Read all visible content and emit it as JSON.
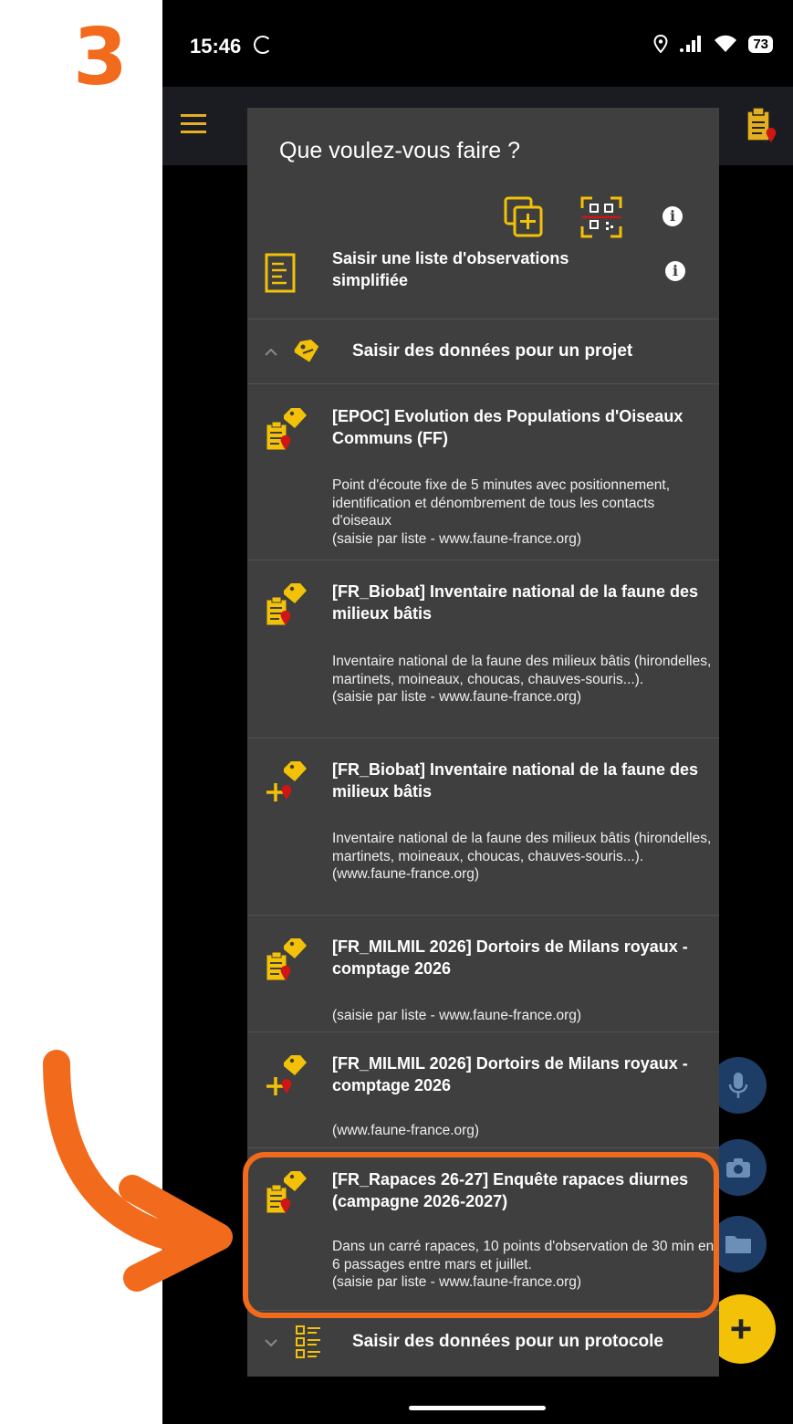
{
  "annotation": {
    "step_number": "3",
    "accent_color": "#f26a1b"
  },
  "status_bar": {
    "time": "15:46",
    "battery": "73",
    "icons": [
      "location-icon",
      "signal-icon",
      "wifi-icon",
      "battery-icon"
    ]
  },
  "dialog": {
    "title": "Que voulez-vous faire ?",
    "toolbar_icons": [
      "duplicate-add-icon",
      "qr-scan-icon",
      "info-icon"
    ],
    "simple_list": {
      "label": "Saisir une liste d'observations simplifiée",
      "icon": "list-icon"
    },
    "projects_section": {
      "label": "Saisir des données pour un projet",
      "expanded": true
    },
    "projects": [
      {
        "title": "[EPOC] Evolution des Populations d'Oiseaux Communs (FF)",
        "description": "Point d'écoute fixe de 5 minutes avec positionnement, identification et dénombrement de tous les contacts d'oiseaux\n(saisie par liste - www.faune-france.org)",
        "icon": "project-list-icon"
      },
      {
        "title": "[FR_Biobat] Inventaire national de la faune des milieux bâtis",
        "description": "Inventaire national de la faune des milieux bâtis (hirondelles, martinets, moineaux, choucas, chauves-souris...).\n(saisie par liste - www.faune-france.org)",
        "icon": "project-list-icon"
      },
      {
        "title": "[FR_Biobat] Inventaire national de la faune des milieux bâtis",
        "description": "Inventaire national de la faune des milieux bâtis (hirondelles, martinets, moineaux, choucas, chauves-souris...).\n(www.faune-france.org)",
        "icon": "project-add-icon"
      },
      {
        "title": "[FR_MILMIL 2026] Dortoirs de Milans royaux - comptage 2026",
        "description": "(saisie par liste - www.faune-france.org)",
        "icon": "project-list-icon"
      },
      {
        "title": "[FR_MILMIL 2026] Dortoirs de Milans royaux - comptage 2026",
        "description": "(www.faune-france.org)",
        "icon": "project-add-icon"
      },
      {
        "title": "[FR_Rapaces 26-27] Enquête rapaces diurnes (campagne 2026-2027)",
        "description": "Dans un carré rapaces, 10 points d'observation  de 30 min en 6 passages entre mars et juillet.\n(saisie par liste - www.faune-france.org)",
        "icon": "project-list-icon",
        "highlighted": true
      }
    ],
    "protocol_section": {
      "label": "Saisir des données pour un protocole",
      "expanded": false
    }
  },
  "fab_buttons": [
    "mic-icon",
    "camera-icon",
    "folder-icon",
    "add-icon"
  ],
  "fab_add_label": "+",
  "colors": {
    "accent": "#f3c107",
    "dialog_bg": "#3f3f3f",
    "appbar_bg": "#1a1c22",
    "fab_bg": "#1d3d66"
  }
}
